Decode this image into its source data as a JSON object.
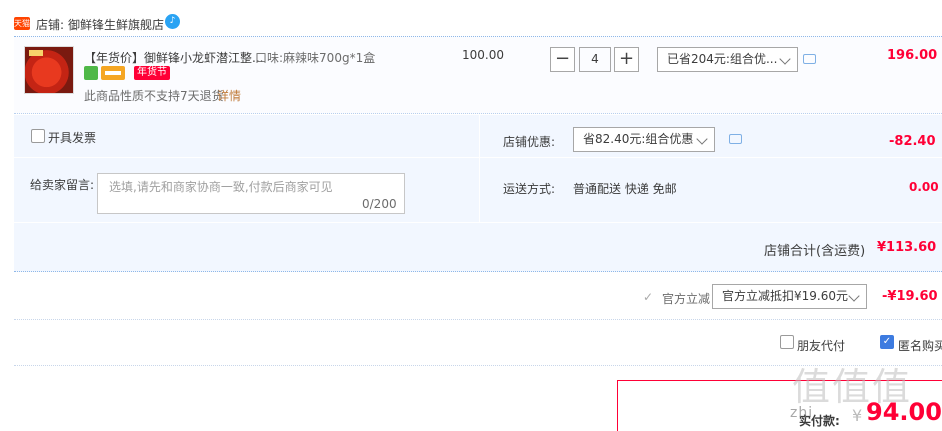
{
  "store": {
    "badge": "天猫",
    "prefix": "店铺:",
    "name": "御鲜锋生鲜旗舰店",
    "chat_icon": "wangwang-chat-icon"
  },
  "item": {
    "title": "【年货价】御鲜锋小龙虾潜江整...",
    "sku": "口味:麻辣味700g*1盒",
    "badge": "年货节",
    "return_note": "此商品性质不支持7天退货",
    "return_link": "详情",
    "unit_price": "100.00",
    "quantity": "4",
    "qty_minus": "−",
    "qty_plus": "+",
    "promo": "已省204元:组合优...",
    "total": "196.00"
  },
  "options": {
    "invoice_label": "开具发票",
    "message_label": "给卖家留言:",
    "message_placeholder": "选填,请先和商家协商一致,付款后商家可见",
    "message_count": "0/200",
    "shop_discount_label": "店铺优惠:",
    "shop_discount_value": "省82.40元:组合优惠",
    "shop_discount_amount": "-82.40",
    "shipping_label": "运送方式:",
    "shipping_value": "普通配送 快递 免邮",
    "shipping_amount": "0.00",
    "store_total_label": "店铺合计(含运费)",
    "store_total_amount": "¥113.60"
  },
  "official": {
    "checkmark": "✓",
    "label": "官方立减",
    "select_value": "官方立减抵扣¥19.60元",
    "amount": "-¥19.60"
  },
  "extras": {
    "friend_pay_label": "朋友代付",
    "anonymous_label": "匿名购买",
    "anonymous_check": "✓"
  },
  "payment": {
    "label": "实付款:",
    "currency": "¥",
    "amount": "94.00"
  },
  "watermark": {
    "text": "值值值",
    "sub": "zhi"
  },
  "colors": {
    "price_red": "#ff0036",
    "accent_blue": "#3d7be0",
    "panel_bg": "#f2f7ff"
  }
}
